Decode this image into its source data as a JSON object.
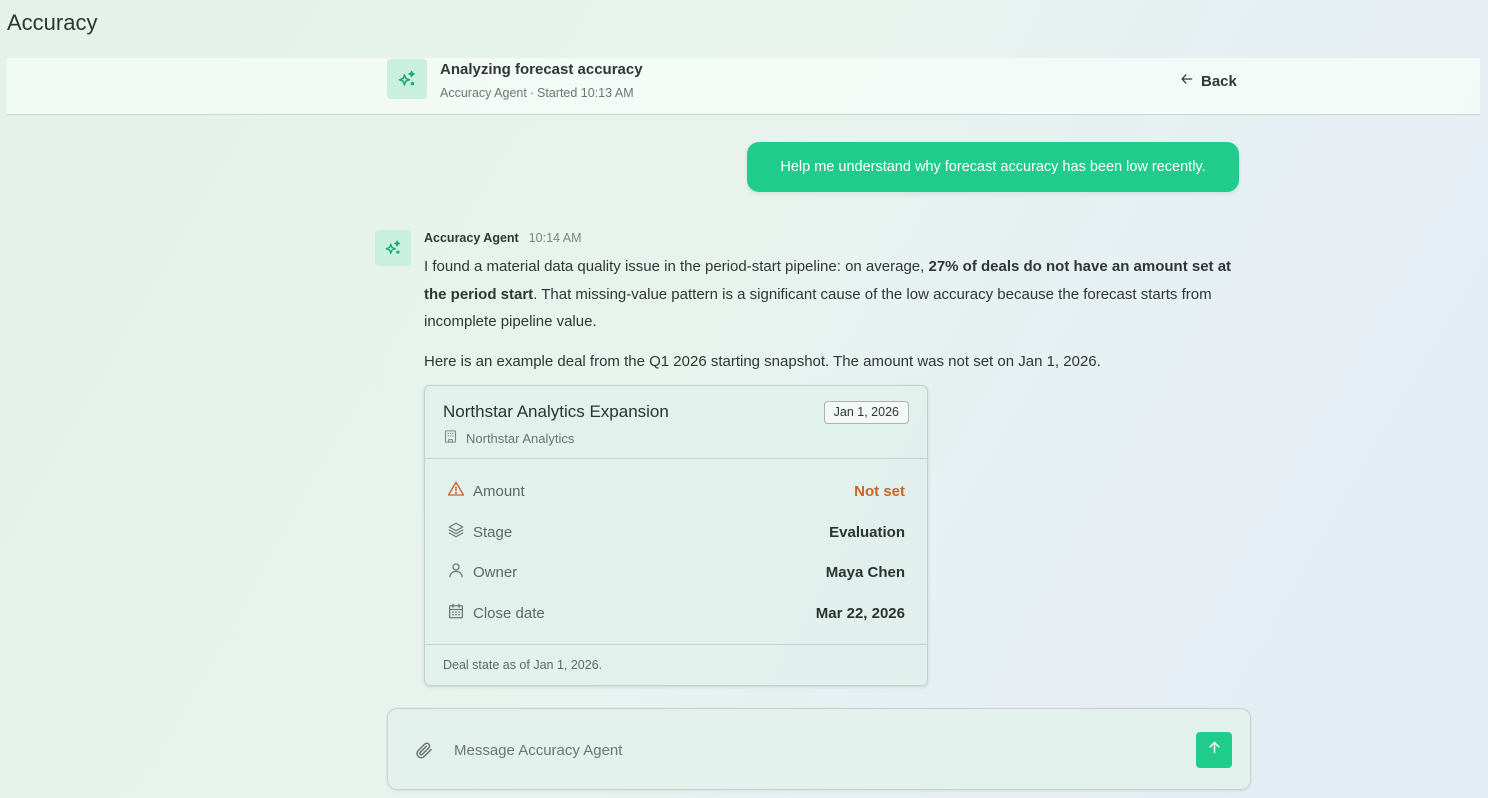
{
  "page": {
    "title": "Accuracy"
  },
  "header": {
    "icon": "sparkles-icon",
    "title": "Analyzing forecast accuracy",
    "agent_name": "Accuracy Agent",
    "separator": "·",
    "started_label": "Started 10:13 AM",
    "back_label": "Back",
    "back_icon": "arrow-left-icon"
  },
  "conversation": {
    "user_message": "Help me understand why forecast accuracy has been low recently.",
    "agent_message": {
      "author": "Accuracy Agent",
      "time": "10:14 AM",
      "p1_before": "I found a material data quality issue in the period-start pipeline: on average, ",
      "p1_bold": "27% of deals do not have an amount set at the period start",
      "p1_after": ". That missing-value pattern is a significant cause of the low accuracy because the forecast starts from incomplete pipeline value.",
      "p2": "Here is an example deal from the Q1 2026 starting snapshot. The amount was not set on Jan 1, 2026."
    }
  },
  "deal_card": {
    "name": "Northstar Analytics Expansion",
    "date_badge": "Jan 1, 2026",
    "company_icon": "building-icon",
    "company": "Northstar Analytics",
    "rows": [
      {
        "icon": "warning-icon",
        "label": "Amount",
        "value": "Not set",
        "status_color": "#c9642a"
      },
      {
        "icon": "layers-icon",
        "label": "Stage",
        "value": "Evaluation"
      },
      {
        "icon": "user-icon",
        "label": "Owner",
        "value": "Maya Chen"
      },
      {
        "icon": "calendar-icon",
        "label": "Close date",
        "value": "Mar 22, 2026"
      }
    ],
    "footer": "Deal state as of Jan 1, 2026."
  },
  "composer": {
    "placeholder": "Message Accuracy Agent",
    "value": "",
    "attach_icon": "paperclip-icon",
    "send_icon": "arrow-up-icon"
  },
  "colors": {
    "accent": "#1fcc8c",
    "icon_bg": "#c9f0de",
    "warning": "#c9642a"
  }
}
